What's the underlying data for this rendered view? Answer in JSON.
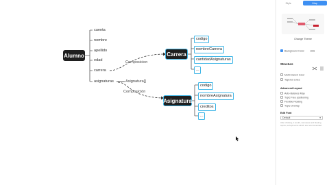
{
  "map": {
    "root": "Alumno",
    "attributes": [
      "cuenta",
      "nombre",
      "apellido",
      "edad",
      "carrera",
      "asignaturas"
    ],
    "relations": {
      "composicion1": "Composicion",
      "asignatura_array": "Asignatura[]",
      "composicion2": "Composición"
    },
    "carrera": {
      "title": "Carrera",
      "children": [
        "codigo",
        "nombreCarrera",
        "cantidadAsignaturas",
        "..."
      ]
    },
    "asignatura": {
      "title": "Asignatura",
      "children": [
        "codigo",
        "nombreAsignatura",
        "creditos",
        "..."
      ]
    }
  },
  "panel": {
    "tabs": [
      "Style",
      "Map"
    ],
    "active_tab": "Map",
    "change_theme": "Change Theme",
    "background_color": "Background Color",
    "structure_label": "Structure",
    "multi_branch_color": "Multi-branch Color",
    "tapered_lines": "Tapered Lines",
    "advanced_layout": "Advanced Layout",
    "auto_balance": "Auto-Balance Map",
    "free_positioning": "Topic Free positioning",
    "flexible_floating": "Flexible Floating",
    "overlap": "Topic Overlap",
    "edit_font": "Edit Font",
    "font_default": "Default",
    "hint": "After clicking, it would, canvases and floating topics, except some which are recommended"
  },
  "colors": {
    "accent": "#3db5e6",
    "root_bg": "#1f1f1f",
    "tab_active": "#3d8ff2"
  }
}
